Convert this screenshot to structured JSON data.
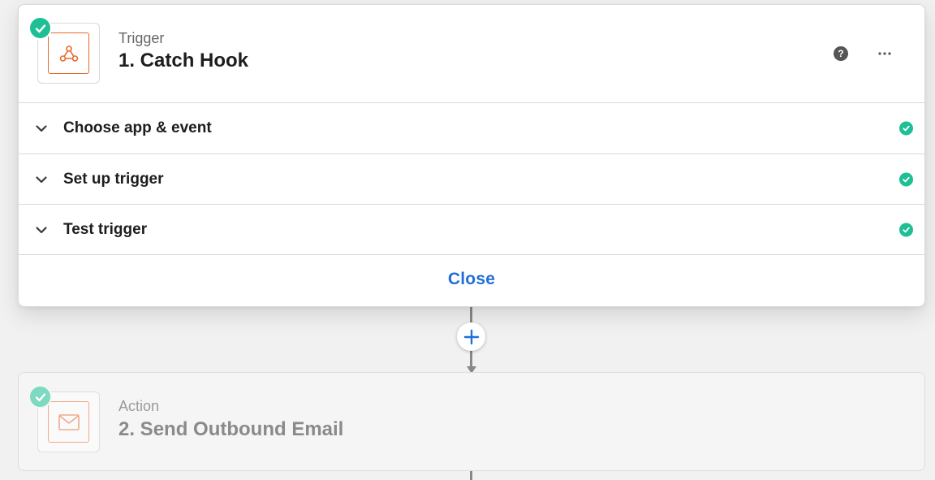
{
  "trigger_step": {
    "type_label": "Trigger",
    "title": "1. Catch Hook",
    "app_icon": "webhook-icon",
    "status": "complete",
    "help_icon": "help-circle-icon",
    "help_glyph": "?",
    "more_icon": "more-horizontal-icon",
    "sections": [
      {
        "label": "Choose app & event",
        "status": "complete"
      },
      {
        "label": "Set up trigger",
        "status": "complete"
      },
      {
        "label": "Test trigger",
        "status": "complete"
      }
    ],
    "close_label": "Close"
  },
  "connector": {
    "add_icon": "plus-icon"
  },
  "action_step": {
    "type_label": "Action",
    "title": "2. Send Outbound Email",
    "app_icon": "email-icon",
    "status": "complete"
  },
  "colors": {
    "success": "#1fbf95",
    "link": "#1f6fd9",
    "app_accent": "#e86a2b",
    "background": "#f1f1f1"
  }
}
